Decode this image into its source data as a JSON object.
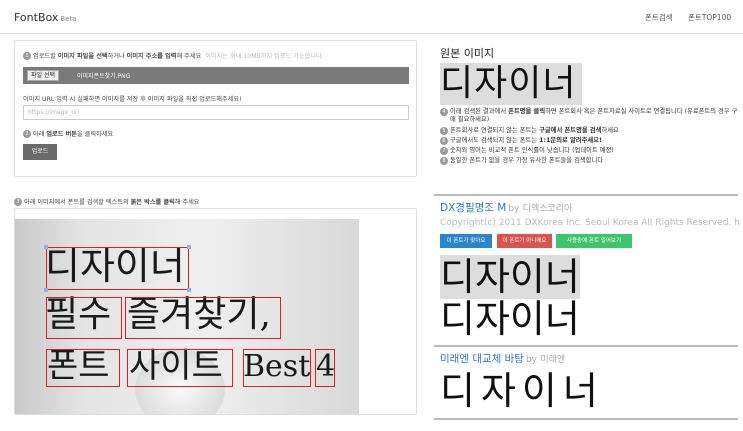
{
  "navbar": {
    "brand": "FontBox",
    "beta": "Beta",
    "links": [
      "폰트검색",
      "폰트TOP100"
    ]
  },
  "upload": {
    "step1_prefix": "업로드할 ",
    "step1_bold1": "이미지 파일을 선택",
    "step1_mid": "하거나 ",
    "step1_bold2": "이미지 주소를 입력",
    "step1_suffix": "해 주세요",
    "step1_hint": "이미지는 최대 10MB까지 업로드 가능합니다.",
    "file_button": "파일 선택",
    "file_name": "이미지폰트찾기.PNG",
    "url_help": "이미지 URL 입력 시 실패하면 이미지를 저장 후 이미지 파일을 직접 업로드해주세요!",
    "url_placeholder": "https://image_url",
    "url_value": "",
    "step2_prefix": "아래 ",
    "step2_bold": "업로드 버튼",
    "step2_suffix": "을 클릭하세요",
    "upload_button": "업로드",
    "step_numbers": [
      "1",
      "2",
      "3"
    ]
  },
  "image_panel": {
    "step3_prefix": "아래 이미지에서 폰트를 검색할 텍스트의 ",
    "step3_bold": "붉은 박스를 클릭",
    "step3_suffix": "해 주세요",
    "words": [
      "디자이너",
      "필수",
      "즐겨찾기,",
      "폰트",
      "사이트",
      "Best",
      "4"
    ]
  },
  "original": {
    "title": "원본 이미지",
    "preview_text": "디자이너",
    "tips": [
      {
        "n": "4",
        "pre": "아래 검색된 결과에서 ",
        "bold": "폰트명을 클릭",
        "post": "하면 폰트회사 혹은 폰트자료실 사이트로 연결됩니다 (유료폰트의 경우 구매 필요하세요)"
      },
      {
        "n": "5",
        "pre": "폰트회사로 연결되지 않는 폰트는 ",
        "bold": "구글에서 폰트명을 검색",
        "post": "하세요"
      },
      {
        "n": "6",
        "pre": "구글에서도 검색되지 않는 폰트는 ",
        "bold": "1:1문의로 알려주세요!",
        "post": ""
      },
      {
        "n": "7",
        "pre": "숫자와 영어는 비교적 폰트 인식률이 낮습니다 (업데이트 예정)",
        "bold": "",
        "post": ""
      },
      {
        "n": "8",
        "pre": "동일한 폰트가 없을 경우 가장 유사한 폰트들을 검색합니다",
        "bold": "",
        "post": ""
      }
    ]
  },
  "results": [
    {
      "name": "DX경필명조 M",
      "by": "by",
      "maker": "디엑스코리아",
      "copyright": "Copyright(c) 2011 DXKorea Inc. Seoul Korea All Rights Reserved. http://www.dxkorea.co.kr",
      "buttons": [
        "이 폰트가 맞아요",
        "이 폰트가 아니에요",
        "사용중에 폰트 열어보기"
      ],
      "sample_highlighted": "디자이너",
      "sample": "디자이너"
    },
    {
      "name": "미래엔 대교체 바탕",
      "by": "by",
      "maker": "미래엔",
      "sample": "디자이너"
    }
  ],
  "colors": {
    "accent_blue": "#2a86c8",
    "danger_red": "#d9534f",
    "success_green": "#3ec46d",
    "box_red": "#e02020",
    "link_blue": "#2b7bc0"
  }
}
